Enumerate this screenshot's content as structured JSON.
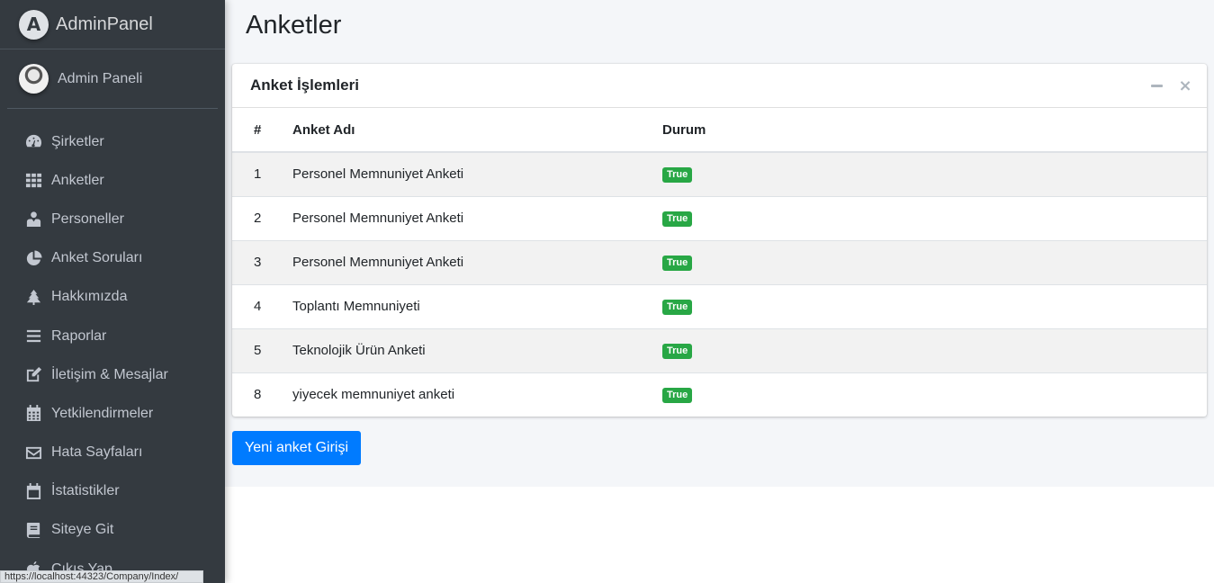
{
  "brand": {
    "logo_letter": "A",
    "text": "AdminPanel"
  },
  "user": {
    "name": "Admin Paneli"
  },
  "sidebar": {
    "items": [
      {
        "label": "Şirketler",
        "icon": "tachometer-icon"
      },
      {
        "label": "Anketler",
        "icon": "th-grid-icon"
      },
      {
        "label": "Personeller",
        "icon": "user-tie-icon"
      },
      {
        "label": "Anket Soruları",
        "icon": "pie-chart-icon"
      },
      {
        "label": "Hakkımızda",
        "icon": "tree-icon"
      },
      {
        "label": "Raporlar",
        "icon": "bars-icon"
      },
      {
        "label": "İletişim & Mesajlar",
        "icon": "edit-icon"
      },
      {
        "label": "Yetkilendirmeler",
        "icon": "calendar-days-icon"
      },
      {
        "label": "Hata Sayfaları",
        "icon": "envelope-icon"
      },
      {
        "label": "İstatistikler",
        "icon": "calendar-icon"
      },
      {
        "label": "Siteye Git",
        "icon": "book-icon"
      },
      {
        "label": "Çıkış Yap",
        "icon": "apple-icon"
      }
    ]
  },
  "page": {
    "title": "Anketler"
  },
  "card": {
    "title": "Anket İşlemleri",
    "minimize_icon": "minus-icon",
    "close_icon": "times-icon",
    "close_glyph": "×"
  },
  "table": {
    "headers": [
      "#",
      "Anket Adı",
      "Durum"
    ],
    "rows": [
      {
        "id": "1",
        "name": "Personel Memnuniyet Anketi",
        "status": "True"
      },
      {
        "id": "2",
        "name": "Personel Memnuniyet Anketi",
        "status": "True"
      },
      {
        "id": "3",
        "name": "Personel Memnuniyet Anketi",
        "status": "True"
      },
      {
        "id": "4",
        "name": "Toplantı Memnuniyeti",
        "status": "True"
      },
      {
        "id": "5",
        "name": "Teknolojik Ürün Anketi",
        "status": "True"
      },
      {
        "id": "8",
        "name": "yiyecek memnuniyet anketi",
        "status": "True"
      }
    ]
  },
  "actions": {
    "new_survey_label": "Yeni anket Girişi"
  },
  "statusbar": {
    "url": "https://localhost:44323/Company/Index/"
  },
  "colors": {
    "sidebar_bg": "#343a40",
    "primary": "#007bff",
    "success": "#28a745",
    "content_bg": "#f4f6f9"
  }
}
